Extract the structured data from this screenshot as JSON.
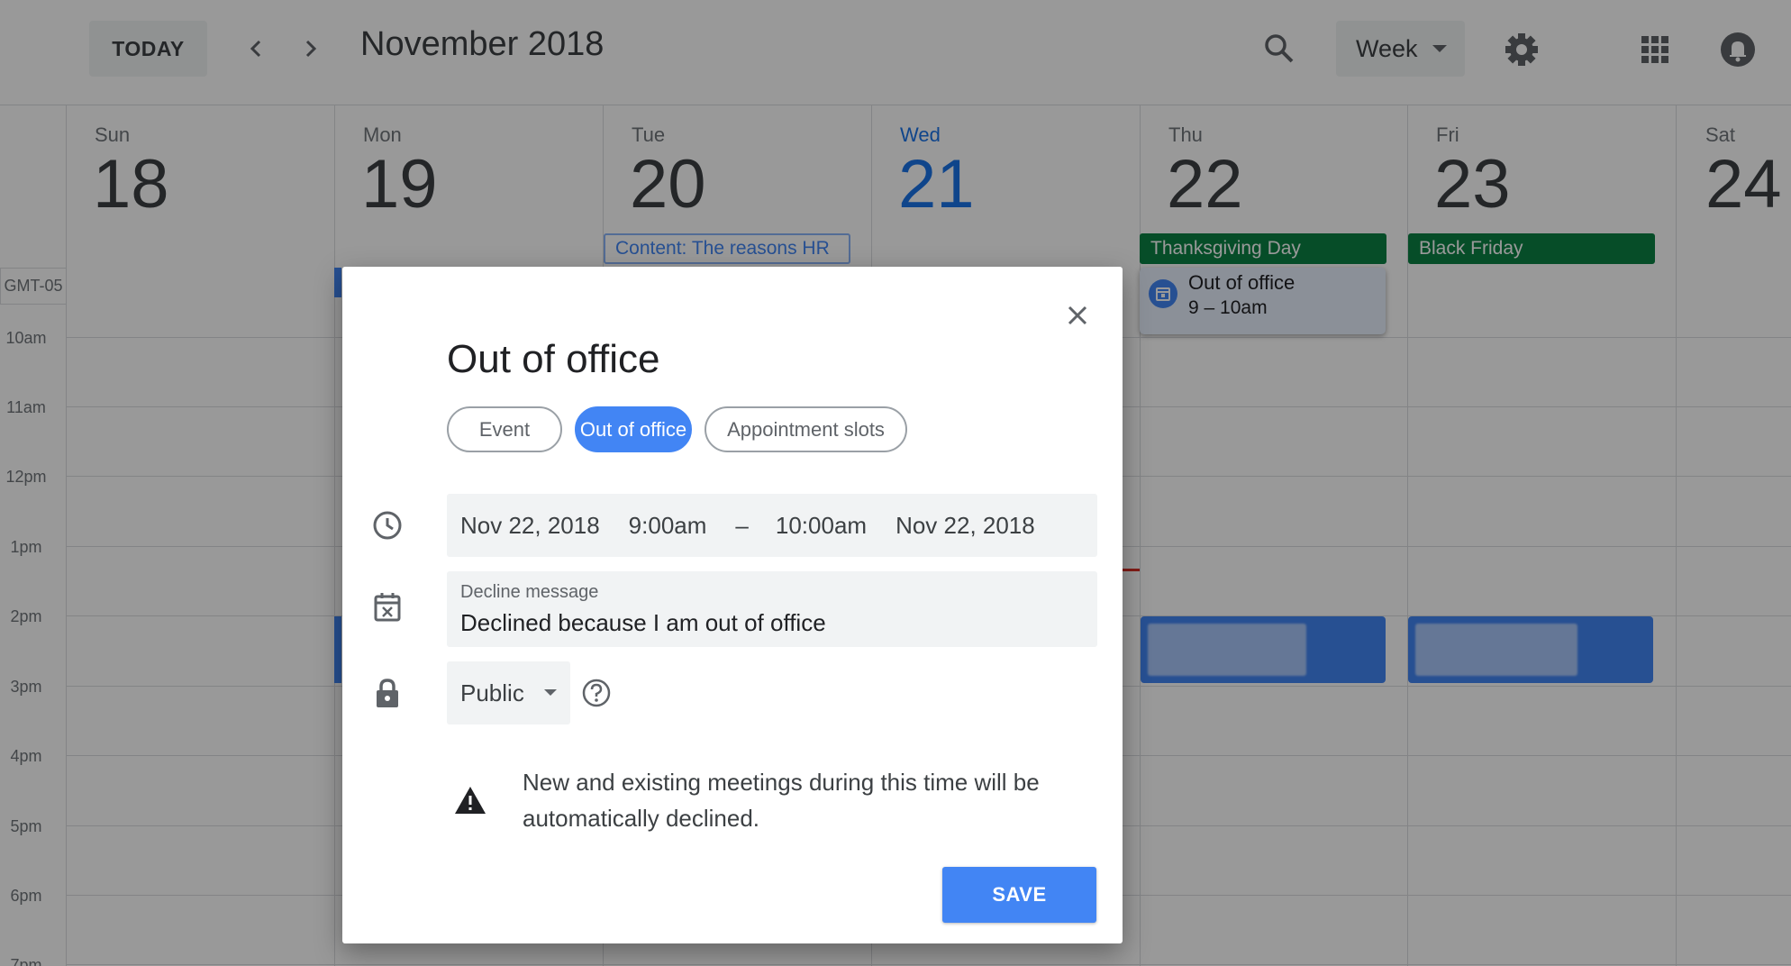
{
  "header": {
    "today_label": "TODAY",
    "month_title": "November 2018",
    "view_label": "Week",
    "icons": [
      "chevron-left-icon",
      "chevron-right-icon",
      "search-icon",
      "gear-icon",
      "apps-icon",
      "notifications-icon"
    ]
  },
  "days": [
    {
      "name": "Sun",
      "num": "18"
    },
    {
      "name": "Mon",
      "num": "19"
    },
    {
      "name": "Tue",
      "num": "20"
    },
    {
      "name": "Wed",
      "num": "21"
    },
    {
      "name": "Thu",
      "num": "22"
    },
    {
      "name": "Fri",
      "num": "23"
    },
    {
      "name": "Sat",
      "num": "24"
    }
  ],
  "allday_events": {
    "tue": "Content: The reasons HR",
    "thu": "Thanksgiving Day",
    "fri": "Black Friday"
  },
  "timezone": "GMT-05",
  "time_labels": [
    "10am",
    "11am",
    "12pm",
    "1pm",
    "2pm",
    "3pm",
    "4pm",
    "5pm",
    "6pm",
    "7pm"
  ],
  "ooo_event": {
    "title": "Out of office",
    "time": "9 – 10am"
  },
  "dialog": {
    "title": "Out of office",
    "chips": {
      "event": "Event",
      "ooo": "Out of office",
      "slots": "Appointment slots"
    },
    "start_date": "Nov 22, 2018",
    "start_time": "9:00am",
    "dash": "–",
    "end_time": "10:00am",
    "end_date": "Nov 22, 2018",
    "decline_label": "Decline message",
    "decline_value": "Declined because I am out of office",
    "visibility": "Public",
    "warning": "New and existing meetings during this time will be automatically declined.",
    "save_label": "SAVE"
  },
  "colors": {
    "accent": "#4285f4",
    "today": "#1a73e8",
    "holiday": "#0b8043",
    "now_line": "#d93025"
  }
}
